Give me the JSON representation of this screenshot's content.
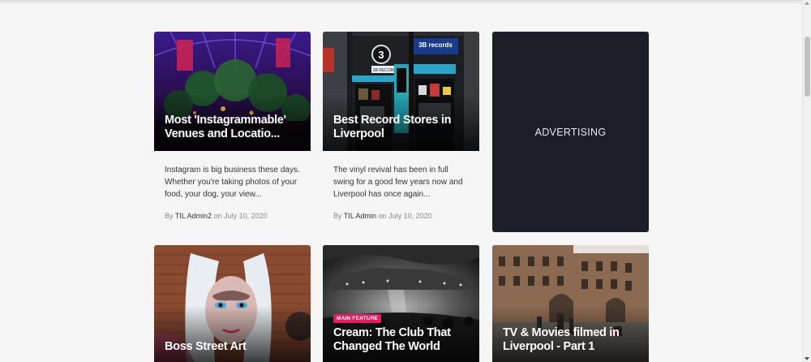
{
  "cards": [
    {
      "title": "Most 'Instagrammable' Venues and Locatio...",
      "excerpt": "Instagram is big business these days. Whether you're taking photos of your food, your dog, your view...",
      "by": "By",
      "author": "TIL Admin2",
      "on": "on",
      "date": "July 10, 2020"
    },
    {
      "title": "Best Record Stores in Liverpool",
      "excerpt": "The vinyl revival has been in full swing for a good few years now and Liverpool has once again...",
      "by": "By",
      "author": "TIL Admin",
      "on": "on",
      "date": "July 10, 2020"
    },
    {
      "title": "Boss Street Art"
    },
    {
      "badge": "MAIN FEATURE",
      "title": "Cream: The Club That Changed The World"
    },
    {
      "title": "TV & Movies filmed in Liverpool - Part 1"
    }
  ],
  "ad": {
    "label": "ADVERTISING"
  },
  "store_signs": {
    "number": "3",
    "sign": "3B records",
    "sub": "3B RECORDS",
    "vertical": "3Brecords"
  }
}
